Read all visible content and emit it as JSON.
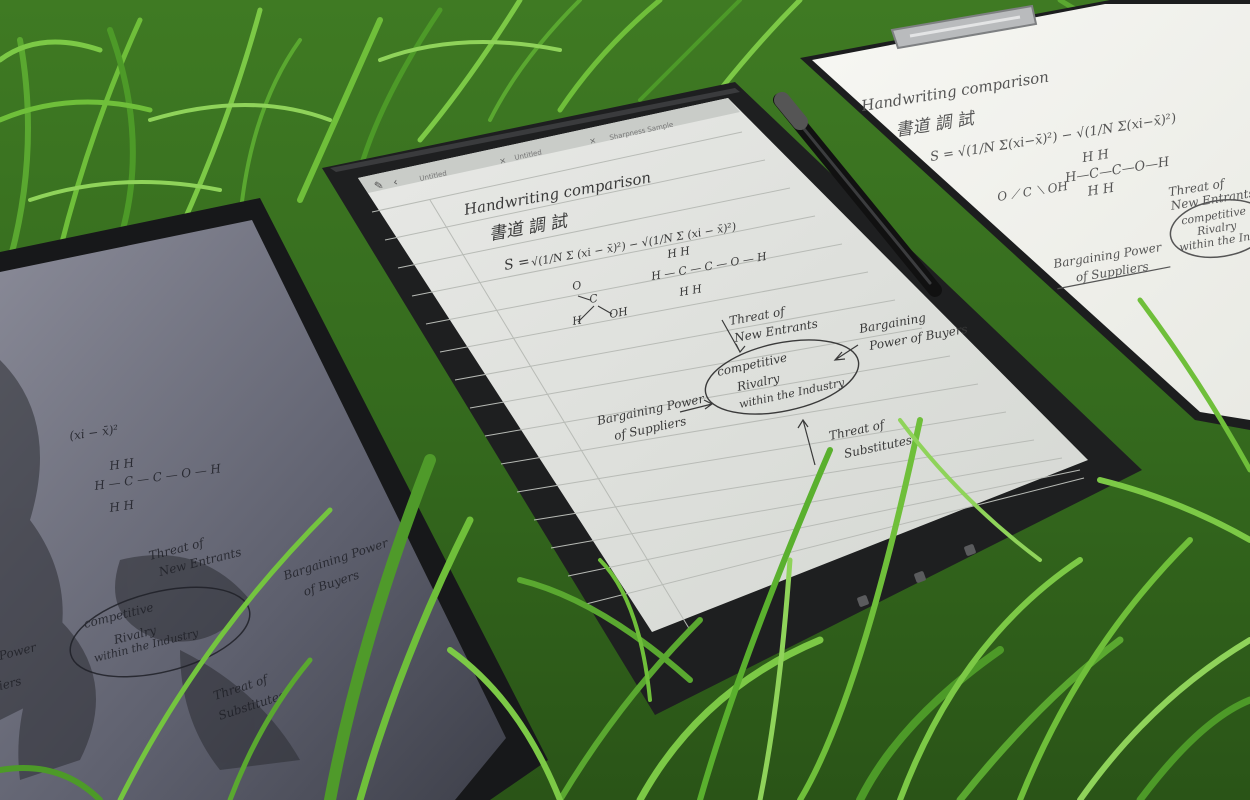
{
  "colors": {
    "grass_dark": "#2f5e1c",
    "grass_light": "#6fbf3a",
    "ereader_bezel": "#1e1f20",
    "ereader_screen": "#dfe1dd",
    "tablet_screen": "#6d6f7e",
    "clipboard_paper": "#f4f4f0",
    "ink": "#3a3a3a"
  },
  "ereader": {
    "tab_labels": [
      "Untitled",
      "Untitled",
      "Sharpness Sample"
    ],
    "title": "Handwriting comparison",
    "chinese": "書道 調 試",
    "formula_lhs": "S =",
    "formula_rhs": "√(1/N Σ (xi − x̄)²) − √(1/N Σ (xi − x̄)²)",
    "acid_h": "H",
    "acid_c": "C",
    "acid_o": "O",
    "acid_oh": "OH",
    "ethanol_top": "H   H",
    "ethanol_mid": "H — C — C — O — H",
    "ethanol_bot": "H   H",
    "new_entrants_1": "Threat of",
    "new_entrants_2": "New Entrants",
    "buyers_1": "Bargaining",
    "buyers_2": "Power of Buyers",
    "rivalry_1": "competitive",
    "rivalry_2": "Rivalry",
    "rivalry_3": "within the Industry",
    "suppliers_1": "Bargaining Power",
    "suppliers_2": "of Suppliers",
    "substitutes_1": "Threat of",
    "substitutes_2": "Substitutes"
  },
  "clipboard": {
    "title": "Handwriting comparison",
    "chinese": "書道 調 試",
    "formula": "S = √(1/N Σ(xi−x̄)²) − √(1/N Σ(xi−x̄)²)",
    "ethanol_top": "H   H",
    "ethanol_mid": "H—C—C—O—H",
    "ethanol_bot": "H   H",
    "acid": "O ⟋ C ⟍ OH",
    "new_entrants_1": "Threat of",
    "new_entrants_2": "New Entrants",
    "rivalry_1": "competitive",
    "rivalry_2": "Rivalry",
    "rivalry_3": "within the Industry",
    "suppliers_1": "Bargaining Power",
    "suppliers_2": "of Suppliers"
  },
  "tablet": {
    "formula": "(xi − x̄)²",
    "ethanol_top": "H   H",
    "ethanol_mid": "H — C — C — O — H",
    "ethanol_bot": "H   H",
    "new_entrants_1": "Threat of",
    "new_entrants_2": "New Entrants",
    "buyers_1": "Bargaining Power",
    "buyers_2": "of Buyers",
    "rivalry_1": "competitive",
    "rivalry_2": "Rivalry",
    "rivalry_3": "within the Industry",
    "suppliers_1": "Power",
    "suppliers_2": "iers",
    "substitutes_1": "Threat of",
    "substitutes_2": "Substitutes"
  }
}
